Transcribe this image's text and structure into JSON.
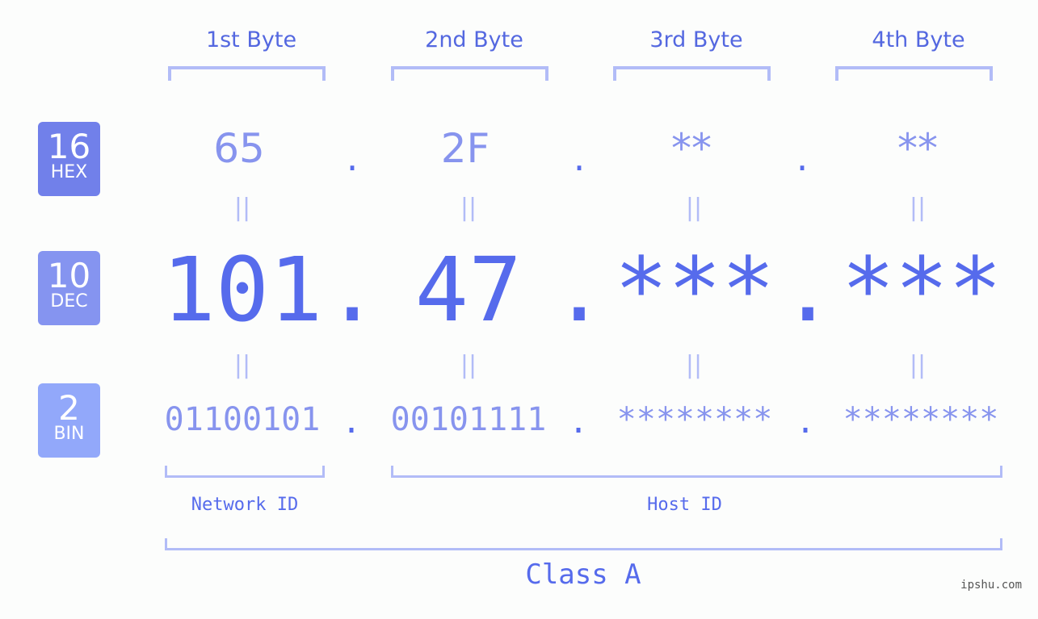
{
  "bytes": [
    {
      "label": "1st Byte",
      "hex": "65",
      "dec": "101",
      "bin": "01100101"
    },
    {
      "label": "2nd Byte",
      "hex": "2F",
      "dec": "47",
      "bin": "00101111"
    },
    {
      "label": "3rd Byte",
      "hex": "**",
      "dec": "***",
      "bin": "********"
    },
    {
      "label": "4th Byte",
      "hex": "**",
      "dec": "***",
      "bin": "********"
    }
  ],
  "badges": {
    "hex": {
      "num": "16",
      "label": "HEX"
    },
    "dec": {
      "num": "10",
      "label": "DEC"
    },
    "bin": {
      "num": "2",
      "label": "BIN"
    }
  },
  "separator": ".",
  "equals": "||",
  "network_id_label": "Network ID",
  "host_id_label": "Host ID",
  "class_label": "Class A",
  "watermark": "ipshu.com",
  "colors": {
    "accent": "#566bec",
    "light": "#8794ee",
    "bracket": "#b2bcf7"
  }
}
